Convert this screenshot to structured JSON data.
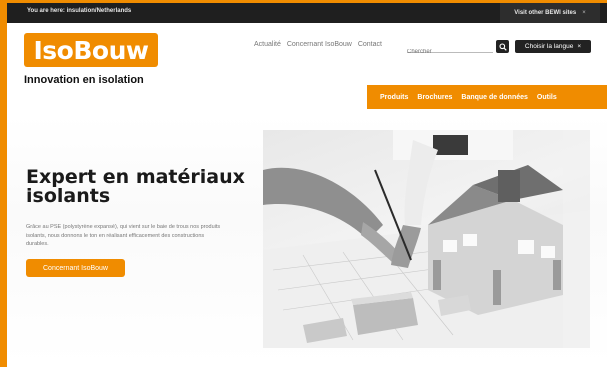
{
  "topbar": {
    "breadcrumb": "You are here: insulation/Netherlands",
    "other_sites": "Visit other BEWI sites",
    "close": "×"
  },
  "brand": {
    "logo_text": "IsoBouw",
    "tagline": "Innovation en isolation",
    "accent_color": "#f08c00"
  },
  "header": {
    "nav": [
      "Actualité",
      "Concernant IsoBouw",
      "Contact"
    ],
    "search_placeholder": "Chercher",
    "language_label": "Choisir la langue",
    "language_close": "×"
  },
  "subnav": {
    "items": [
      "Produits",
      "Brochures",
      "Banque de données",
      "Outils"
    ]
  },
  "hero": {
    "title": "Expert en matériaux isolants",
    "text": "Grâce au PSE (polystyrène expansé), qui vient sur le baie de trous nos produits isolants, nous donnons le ton en réalisant efficacement des constructions durables.",
    "button_label": "Concernant IsoBouw"
  },
  "icons": {
    "search": "search-icon"
  }
}
